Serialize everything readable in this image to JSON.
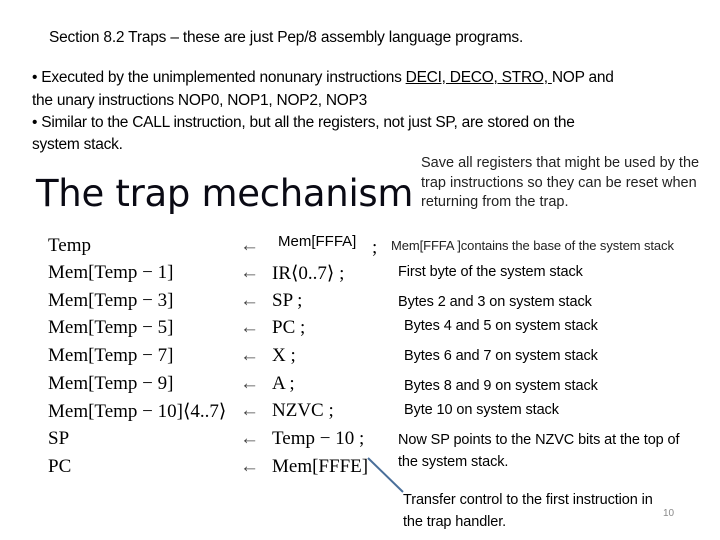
{
  "slide": {
    "section_title": "Section 8.2  Traps – these are just Pep/8 assembly language programs.",
    "bullets": [
      {
        "line1_prefix": "• Executed by the unimplemented nonunary instructions ",
        "line1_underlined": "DECI, DECO, STRO, ",
        "line1_suffix": "NOP and",
        "line2": "the unary instructions NOP0, NOP1, NOP2, NOP3"
      },
      {
        "line1": "• Similar to the CALL instruction, but all the registers, not just SP, are stored on the",
        "line2": "system stack."
      }
    ],
    "heading": "The trap mechanism",
    "save_note": "Save all registers that might be used by the trap instructions so they can be reset when returning from the trap.",
    "assignment_arrow": "←",
    "rtl_rows": [
      {
        "lhs": "Temp",
        "rhs": "Mem[FFFA]",
        "semicolon": ";",
        "note": "Mem[FFFA ]contains the base of the system stack"
      },
      {
        "lhs": "Mem[Temp − 1]",
        "rhs": "IR⟨0..7⟩ ;",
        "note": "First byte of the system stack"
      },
      {
        "lhs": "Mem[Temp − 3]",
        "rhs": "SP ;",
        "note": "Bytes 2 and 3 on system stack"
      },
      {
        "lhs": "Mem[Temp − 5]",
        "rhs": "PC ;",
        "note": "Bytes 4 and 5 on system stack"
      },
      {
        "lhs": "Mem[Temp − 7]",
        "rhs": "X ;",
        "note": "Bytes 6 and 7 on system stack"
      },
      {
        "lhs": "Mem[Temp − 9]",
        "rhs": "A ;",
        "note": "Bytes 8 and 9 on system stack"
      },
      {
        "lhs": "Mem[Temp − 10]⟨4..7⟩",
        "rhs": "NZVC ;",
        "note": "Byte 10 on system stack"
      },
      {
        "lhs": "SP",
        "rhs": "Temp − 10 ;",
        "note_line1": "Now SP points to the NZVC bits at the top of",
        "note_line2": "the system stack."
      },
      {
        "lhs": "PC",
        "rhs": "Mem[FFFE]",
        "note_line1": "Transfer control to the first instruction in",
        "note_line2": "the trap handler."
      }
    ],
    "pointer_color": "#4a6f9a",
    "page_number": "10"
  }
}
